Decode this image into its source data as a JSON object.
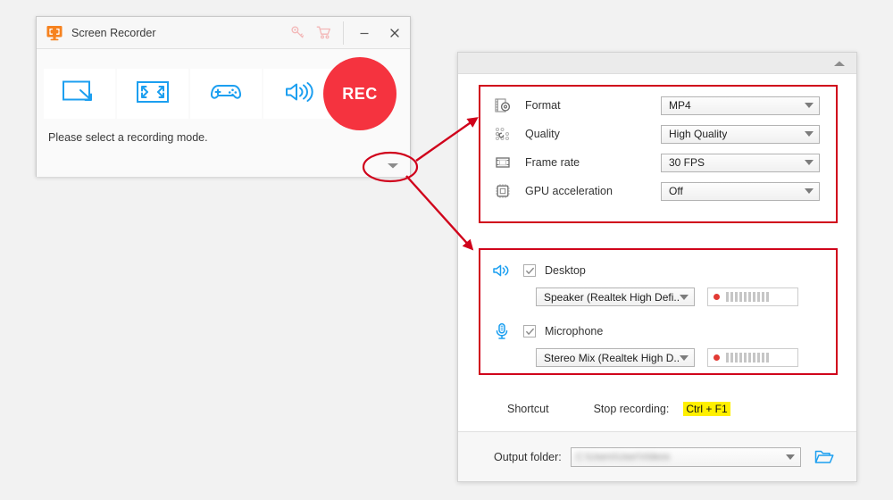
{
  "app": {
    "title": "Screen Recorder",
    "logo_icon": "orange-monitor-logo",
    "titlebar_icons": [
      {
        "name": "key-icon",
        "glyph": "key"
      },
      {
        "name": "cart-icon",
        "glyph": "cart"
      }
    ],
    "window_controls": {
      "minimize_label": "—",
      "close_label": "✕"
    },
    "accent_red": "#f5333f",
    "accent_blue": "#1c9ff0",
    "logo_orange": "#f6821f"
  },
  "recorder": {
    "modes": [
      {
        "name": "region-record-mode",
        "icon": "region-select-icon"
      },
      {
        "name": "fullscreen-record-mode",
        "icon": "fullscreen-icon"
      },
      {
        "name": "game-record-mode",
        "icon": "gamepad-icon"
      },
      {
        "name": "audio-record-mode",
        "icon": "speaker-icon"
      }
    ],
    "rec_button_label": "REC",
    "status_text": "Please select a recording mode.",
    "expand_toggle_icon": "chevron-down-icon"
  },
  "settings": {
    "collapse_toggle_icon": "chevron-up-icon",
    "video": [
      {
        "icon": "film-gear-icon",
        "label": "Format",
        "value": "MP4"
      },
      {
        "icon": "quality-dots-icon",
        "label": "Quality",
        "value": "High Quality"
      },
      {
        "icon": "film-frame-icon",
        "label": "Frame rate",
        "value": "30 FPS"
      },
      {
        "icon": "cpu-chip-icon",
        "label": "GPU acceleration",
        "value": "Off"
      }
    ],
    "audio": [
      {
        "icon": "speaker-icon",
        "label": "Desktop",
        "checked": true,
        "device": "Speaker (Realtek High Defi...",
        "meter_bars": 10
      },
      {
        "icon": "microphone-icon",
        "label": "Microphone",
        "checked": true,
        "device": "Stereo Mix (Realtek High D...",
        "meter_bars": 10
      }
    ],
    "shortcut": {
      "section_label": "Shortcut",
      "stop_label": "Stop recording:",
      "stop_key": "Ctrl + F1",
      "highlight_color": "#fff000"
    },
    "output": {
      "label": "Output folder:",
      "value": "C:\\Users\\User\\Videos",
      "folder_icon": "open-folder-icon"
    }
  },
  "annotations": {
    "color": "#d0021b",
    "shapes": [
      "ellipse-around-expand-toggle",
      "arrow-to-video-settings",
      "arrow-to-audio-settings",
      "box-video-settings",
      "box-audio-settings"
    ]
  }
}
